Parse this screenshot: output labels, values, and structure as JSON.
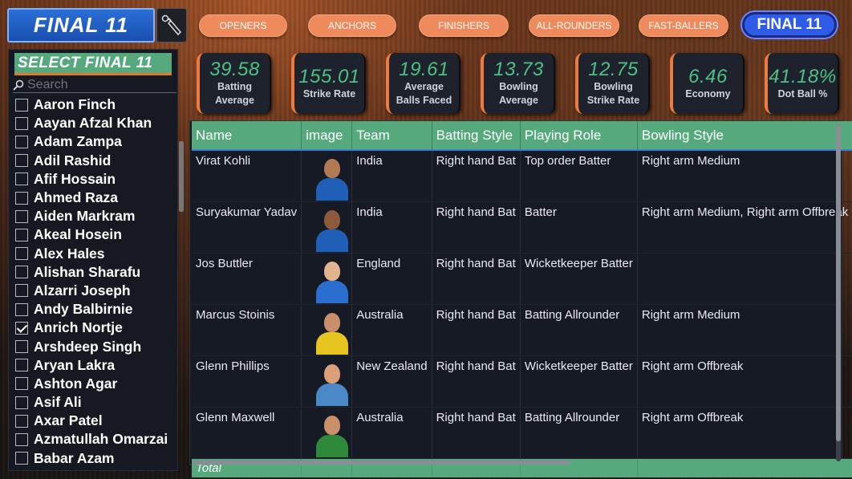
{
  "header": {
    "title": "FINAL 11",
    "bat_icon": "cricket-bat-icon"
  },
  "nav": {
    "pills": [
      "OPENERS",
      "ANCHORS",
      "FINISHERS",
      "ALL-ROUNDERS",
      "FAST-BALLERS"
    ],
    "active": "FINAL 11"
  },
  "slicer": {
    "header": "SELECT FINAL 11",
    "search_placeholder": "Search",
    "items": [
      {
        "label": "Aaron Finch",
        "checked": false
      },
      {
        "label": "Aayan Afzal Khan",
        "checked": false
      },
      {
        "label": "Adam Zampa",
        "checked": false
      },
      {
        "label": "Adil Rashid",
        "checked": false
      },
      {
        "label": "Afif Hossain",
        "checked": false
      },
      {
        "label": "Ahmed Raza",
        "checked": false
      },
      {
        "label": "Aiden Markram",
        "checked": false
      },
      {
        "label": "Akeal Hosein",
        "checked": false
      },
      {
        "label": "Alex Hales",
        "checked": false
      },
      {
        "label": "Alishan Sharafu",
        "checked": false
      },
      {
        "label": "Alzarri Joseph",
        "checked": false
      },
      {
        "label": "Andy Balbirnie",
        "checked": false
      },
      {
        "label": "Anrich Nortje",
        "checked": true
      },
      {
        "label": "Arshdeep Singh",
        "checked": false
      },
      {
        "label": "Aryan Lakra",
        "checked": false
      },
      {
        "label": "Ashton Agar",
        "checked": false
      },
      {
        "label": "Asif Ali",
        "checked": false
      },
      {
        "label": "Axar Patel",
        "checked": false
      },
      {
        "label": "Azmatullah Omarzai",
        "checked": false
      },
      {
        "label": "Babar Azam",
        "checked": false
      }
    ]
  },
  "kpis": [
    {
      "value": "39.58",
      "label_line1": "Batting",
      "label_line2": "Average"
    },
    {
      "value": "155.01",
      "label_line1": "Strike Rate",
      "label_line2": ""
    },
    {
      "value": "19.61",
      "label_line1": "Average",
      "label_line2": "Balls Faced"
    },
    {
      "value": "13.73",
      "label_line1": "Bowling",
      "label_line2": "Average"
    },
    {
      "value": "12.75",
      "label_line1": "Bowling",
      "label_line2": "Strike Rate"
    },
    {
      "value": "6.46",
      "label_line1": "Economy",
      "label_line2": ""
    },
    {
      "value": "41.18%",
      "label_line1": "Dot Ball %",
      "label_line2": ""
    }
  ],
  "table": {
    "columns": [
      "Name",
      "image",
      "Team",
      "Batting Style",
      "Playing Role",
      "Bowling Style"
    ],
    "rows": [
      {
        "name": "Virat Kohli",
        "team": "India",
        "batting": "Right hand Bat",
        "role": "Top order Batter",
        "bowling": "Right arm Medium",
        "shirt": "#1f5fb8",
        "skin": "#b07a55"
      },
      {
        "name": "Suryakumar Yadav",
        "team": "India",
        "batting": "Right hand Bat",
        "role": "Batter",
        "bowling": "Right arm Medium, Right arm Offbreak",
        "shirt": "#1f5fb8",
        "skin": "#8d5a3b"
      },
      {
        "name": "Jos Buttler",
        "team": "England",
        "batting": "Right hand Bat",
        "role": "Wicketkeeper Batter",
        "bowling": "",
        "shirt": "#2a6fd0",
        "skin": "#e2b38f"
      },
      {
        "name": "Marcus Stoinis",
        "team": "Australia",
        "batting": "Right hand Bat",
        "role": "Batting Allrounder",
        "bowling": "Right arm Medium",
        "shirt": "#e8c420",
        "skin": "#c98f6a"
      },
      {
        "name": "Glenn Phillips",
        "team": "New Zealand",
        "batting": "Right hand Bat",
        "role": "Wicketkeeper Batter",
        "bowling": "Right arm Offbreak",
        "shirt": "#4a88c8",
        "skin": "#d9a07a"
      },
      {
        "name": "Glenn Maxwell",
        "team": "Australia",
        "batting": "Right hand Bat",
        "role": "Batting Allrounder",
        "bowling": "Right arm Offbreak",
        "shirt": "#2e8a3a",
        "skin": "#c9906a"
      }
    ],
    "total_label": "Total"
  },
  "colors": {
    "accent_green": "#55a97c",
    "kpi_value": "#4fc085",
    "pill_orange": "#ee8a5c",
    "active_blue": "#2e5be8"
  }
}
